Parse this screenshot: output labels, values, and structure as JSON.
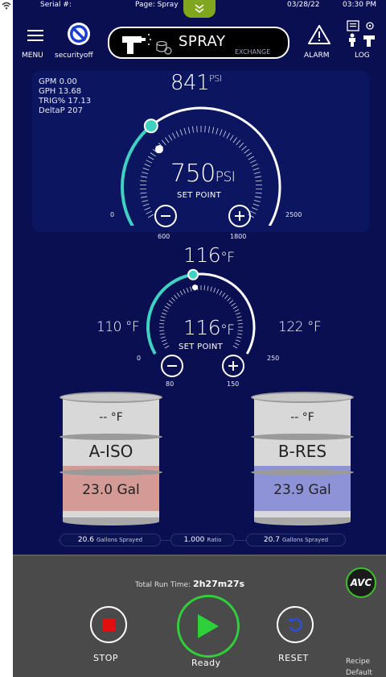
{
  "status": {
    "serial_label": "Serial #:",
    "page_label": "Page: Spray",
    "date": "03/28/22",
    "time": "03:30 PM"
  },
  "header": {
    "menu_label": "MENU",
    "security_label": "securityoff",
    "mode_title": "SPRAY",
    "mode_sub": "EXCHANGE",
    "alarm_label": "ALARM",
    "log_label": "LOG"
  },
  "pressure": {
    "readouts": {
      "gpm": "GPM  0.00",
      "gph": "GPH  13.68",
      "trig": "TRIG% 17.13",
      "deltap": "DeltaP 207"
    },
    "actual": "841",
    "actual_unit": "PSI",
    "set_point": "750",
    "set_unit": "PSI",
    "set_label": "SET POINT",
    "min_label": "0",
    "max_label": "2500",
    "dec_hint": "600",
    "inc_hint": "1800",
    "actual_fraction": 0.336,
    "set_fraction": 0.3
  },
  "temperature": {
    "actual": "116",
    "actual_unit": "°F",
    "set_point": "116",
    "set_unit": "°F",
    "set_label": "SET POINT",
    "left_value": "110 °F",
    "right_value": "122 °F",
    "min_label": "0",
    "max_label": "250",
    "dec_hint": "80",
    "inc_hint": "150",
    "actual_fraction": 0.464,
    "set_fraction": 0.464
  },
  "tanks": {
    "a": {
      "temp": "-- °F",
      "name": "A-ISO",
      "gallons": "23.0  Gal",
      "fill_color": "#d49a96"
    },
    "b": {
      "temp": "-- °F",
      "name": "B-RES",
      "gallons": "23.9  Gal",
      "fill_color": "#8e93d8"
    }
  },
  "sprayed": {
    "a_value": "20.6",
    "a_label": "Gallons Sprayed",
    "ratio_value": "1.000",
    "ratio_label": "Ratio",
    "b_value": "20.7",
    "b_label": "Gallons Sprayed"
  },
  "controls": {
    "runtime_label": "Total Run Time:",
    "runtime_value": "2h27m27s",
    "stop_label": "STOP",
    "start_label": "Ready",
    "reset_label": "RESET",
    "recipe_label": "Recipe",
    "recipe_value": "Default",
    "logo_text": "AVC"
  },
  "colors": {
    "background": "#0a0f52",
    "accent": "#3fd1c2",
    "ready_green": "#2fd13a",
    "stop_red": "#e01010",
    "reset_blue": "#2b4fd8"
  }
}
